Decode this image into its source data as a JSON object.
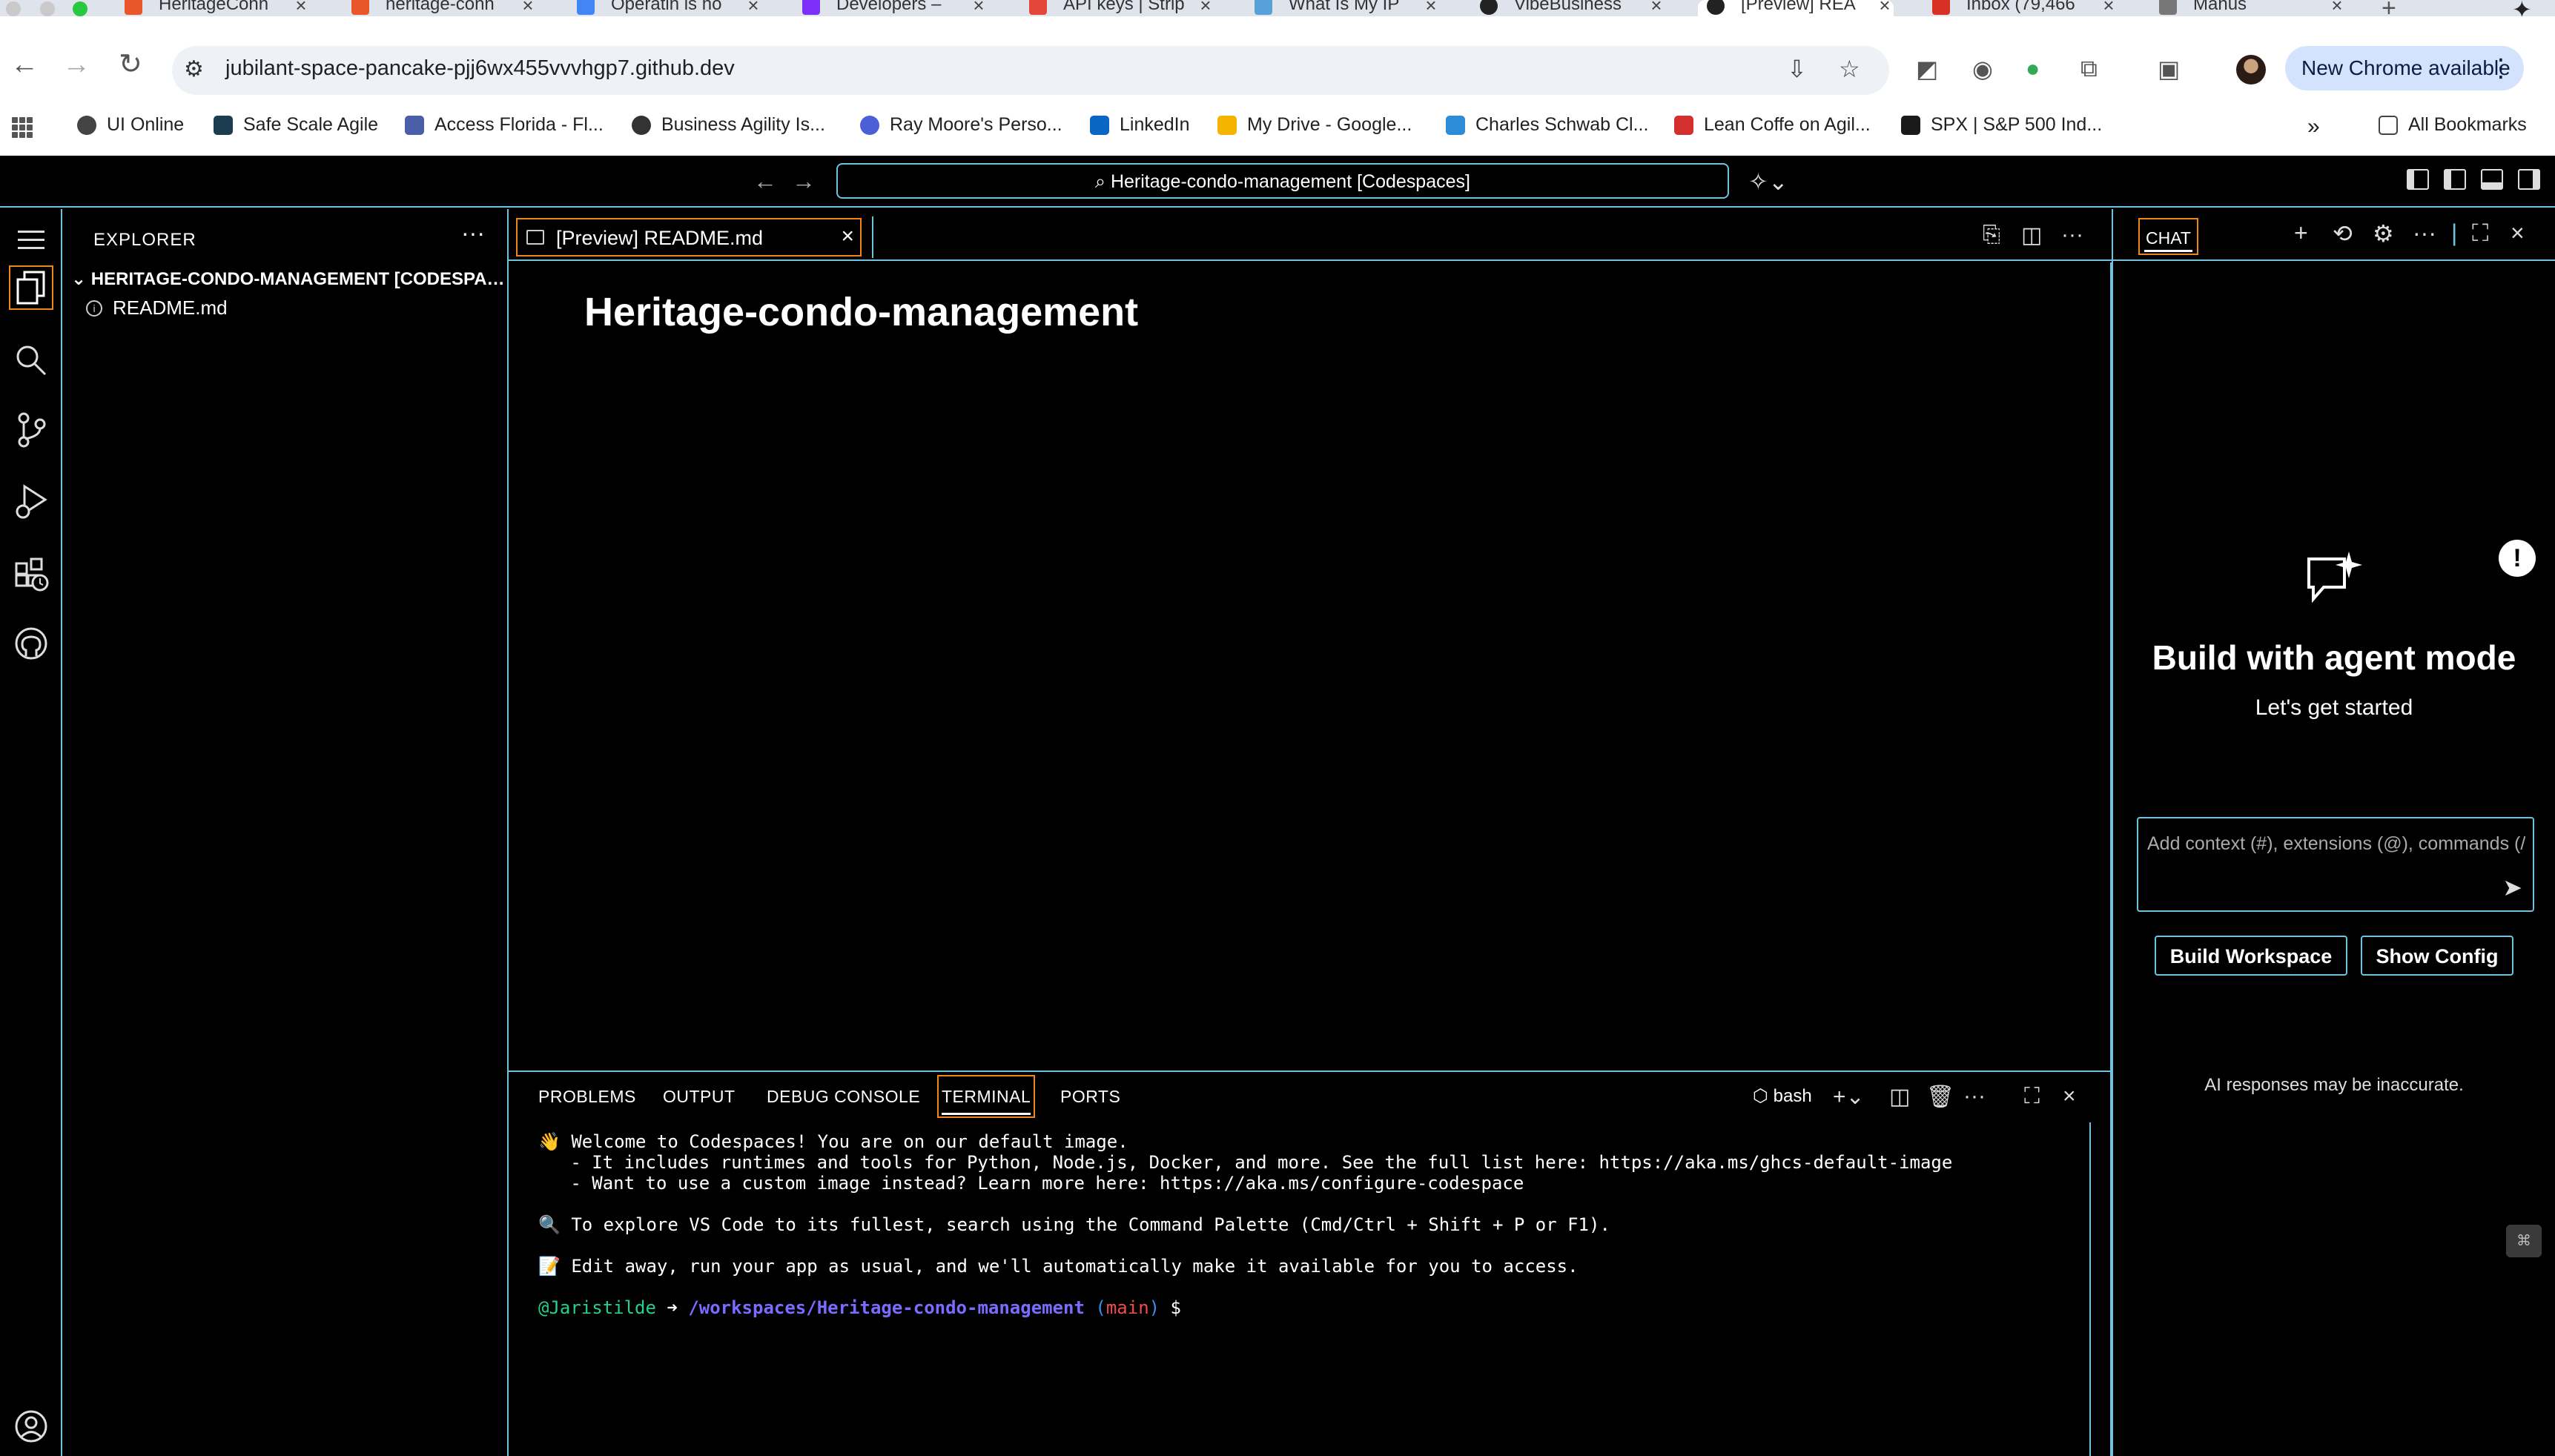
{
  "browser": {
    "tabs": [
      {
        "title": "HeritageConn",
        "color": "#e8562a"
      },
      {
        "title": "heritage-conn",
        "color": "#e8562a"
      },
      {
        "title": "Operatin is ho",
        "color": "#4285f4"
      },
      {
        "title": "Developers – ",
        "color": "#7b2ff7"
      },
      {
        "title": "API keys | Strip",
        "color": "#e5463b"
      },
      {
        "title": "What Is My IP",
        "color": "#5aa0d8"
      },
      {
        "title": "VibeBusiness",
        "color": "#222222"
      },
      {
        "title": "[Preview] REA",
        "color": "#222222"
      },
      {
        "title": "Inbox (79,466",
        "color": "#d93025"
      },
      {
        "title": "Manus",
        "color": "#777777"
      }
    ],
    "url": "jubilant-space-pancake-pjj6wx455vvvhgp7.github.dev",
    "update_button": "New Chrome available",
    "bookmarks": [
      {
        "label": "UI Online",
        "color": "#444444"
      },
      {
        "label": "Safe Scale Agile",
        "color": "#1c3d4f"
      },
      {
        "label": "Access Florida - Fl...",
        "color": "#4a5fa8"
      },
      {
        "label": "Business Agility Is...",
        "color": "#333333"
      },
      {
        "label": "Ray Moore's Perso...",
        "color": "#4a5fd8"
      },
      {
        "label": "LinkedIn",
        "color": "#0a66c2"
      },
      {
        "label": "My Drive - Google...",
        "color": "#f4b400"
      },
      {
        "label": "Charles Schwab Cl...",
        "color": "#2e8bd6"
      },
      {
        "label": "Lean Coffe on Agil...",
        "color": "#d32f2f"
      },
      {
        "label": "SPX | S&P 500 Ind...",
        "color": "#1a1a1a"
      }
    ],
    "all_bookmarks": "All Bookmarks"
  },
  "vscode": {
    "command_center": "Heritage-condo-management [Codespaces]",
    "explorer": {
      "title": "EXPLORER",
      "root": "HERITAGE-CONDO-MANAGEMENT [CODESPACES]",
      "files": [
        "README.md"
      ]
    },
    "editor_tab": "[Preview] README.md",
    "preview_heading": "Heritage-condo-management",
    "panel_tabs": [
      "PROBLEMS",
      "OUTPUT",
      "DEBUG CONSOLE",
      "TERMINAL",
      "PORTS"
    ],
    "shell": "bash",
    "terminal": {
      "line1": "👋 Welcome to Codespaces! You are on our default image.",
      "line2": "   - It includes runtimes and tools for Python, Node.js, Docker, and more. See the full list here: https://aka.ms/ghcs-default-image",
      "line3": "   - Want to use a custom image instead? Learn more here: https://aka.ms/configure-codespace",
      "line4": "🔍 To explore VS Code to its fullest, search using the Command Palette (Cmd/Ctrl + Shift + P or F1).",
      "line5": "📝 Edit away, run your app as usual, and we'll automatically make it available for you to access.",
      "prompt_user": "@Jaristilde",
      "prompt_arrow": "➜",
      "prompt_path": "/workspaces/Heritage-condo-management",
      "prompt_branch": "main",
      "prompt_symbol": "$"
    },
    "chat": {
      "tab": "CHAT",
      "title": "Build with agent mode",
      "subtitle": "Let's get started",
      "input_placeholder": "Add context (#), extensions (@), commands (/)",
      "buttons": [
        "Build Workspace",
        "Show Config"
      ],
      "disclaimer": "AI responses may be inaccurate."
    }
  },
  "colors": {
    "hc_border": "#6fc3df",
    "hc_active": "#f38518"
  }
}
